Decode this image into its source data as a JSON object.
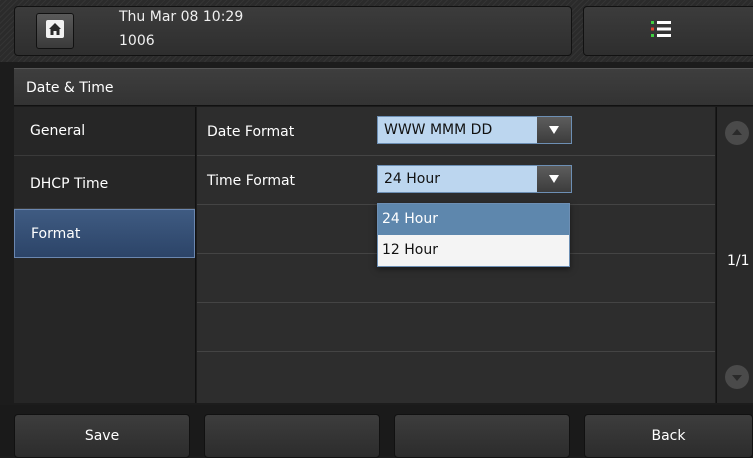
{
  "status": {
    "datetime": "Thu Mar 08 10:29",
    "extension": "1006"
  },
  "icons": {
    "home": "home-icon",
    "menu": "menu-list-icon",
    "scroll_up": "scroll-up-icon",
    "scroll_down": "scroll-down-icon"
  },
  "page": {
    "title": "Date & Time"
  },
  "sidebar": {
    "items": [
      {
        "label": "General"
      },
      {
        "label": "DHCP Time"
      },
      {
        "label": "Format"
      }
    ]
  },
  "form": {
    "date_format": {
      "label": "Date Format",
      "value": "WWW MMM DD"
    },
    "time_format": {
      "label": "Time Format",
      "value": "24 Hour"
    }
  },
  "dropdown": {
    "options": [
      "24 Hour",
      "12 Hour"
    ],
    "selected": "24 Hour"
  },
  "pager": {
    "text": "1/1"
  },
  "softkeys": {
    "save": "Save",
    "key2": "",
    "key3": "",
    "back": "Back"
  },
  "colors": {
    "accent": "#3f5b82",
    "select_bg": "#bcd6ef",
    "dropdown_selected": "#5e87ad",
    "menu_icon_red": "#e0452e",
    "menu_icon_green": "#3fcf3f"
  }
}
